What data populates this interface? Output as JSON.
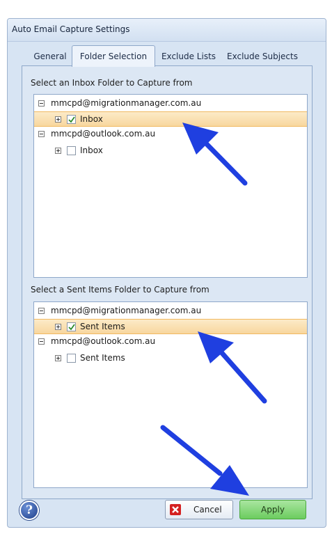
{
  "window": {
    "title": "Auto Email Capture Settings"
  },
  "tabs": [
    {
      "label": "General",
      "active": false
    },
    {
      "label": "Folder Selection",
      "active": true
    },
    {
      "label": "Exclude Lists",
      "active": false
    },
    {
      "label": "Exclude Subjects",
      "active": false
    }
  ],
  "inbox_section": {
    "label": "Select an Inbox Folder to Capture from",
    "accounts": [
      {
        "account": "mmcpd@migrationmanager.com.au",
        "folder": "Inbox",
        "checked": true,
        "selected": true
      },
      {
        "account": "mmcpd@outlook.com.au",
        "folder": "Inbox",
        "checked": false,
        "selected": false
      }
    ]
  },
  "sent_section": {
    "label": "Select a Sent Items Folder to Capture from",
    "accounts": [
      {
        "account": "mmcpd@migrationmanager.com.au",
        "folder": "Sent Items",
        "checked": true,
        "selected": true
      },
      {
        "account": "mmcpd@outlook.com.au",
        "folder": "Sent Items",
        "checked": false,
        "selected": false
      }
    ]
  },
  "buttons": {
    "help_symbol": "?",
    "cancel": "Cancel",
    "apply": "Apply"
  },
  "colors": {
    "selection": "#f8d79e",
    "apply_button": "#6ccc5f",
    "annotation_arrow": "#1f3fe0",
    "cancel_icon": "#d42020"
  },
  "icons": {
    "help": "help-icon",
    "cancel": "close-x-icon",
    "expand": "plus-expander-icon",
    "collapse": "minus-expander-icon"
  }
}
